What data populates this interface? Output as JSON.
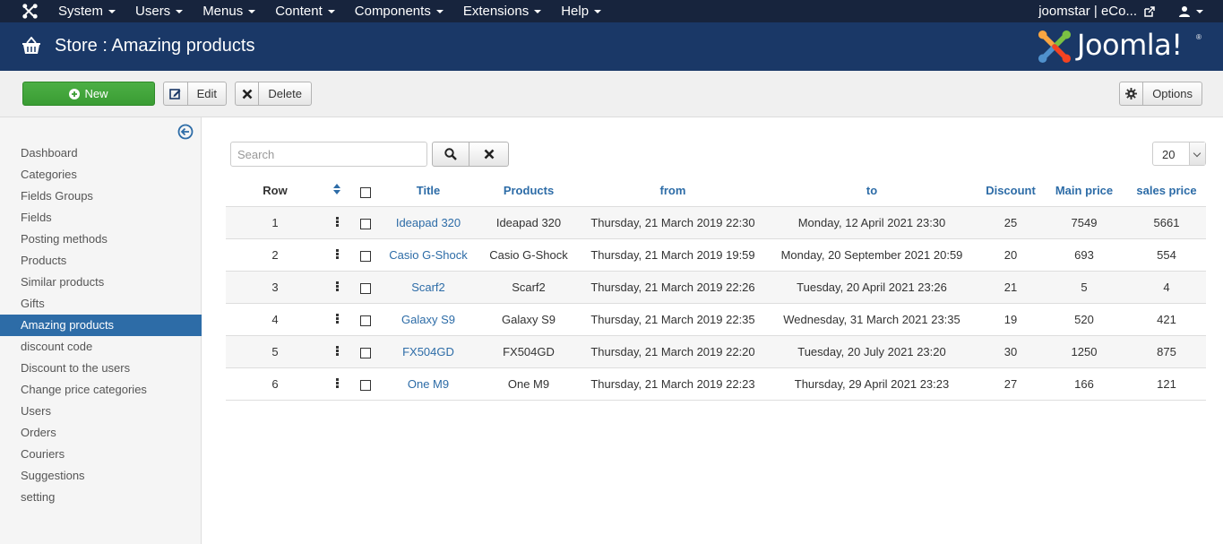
{
  "navbar": {
    "menus": [
      {
        "label": "System"
      },
      {
        "label": "Users"
      },
      {
        "label": "Menus"
      },
      {
        "label": "Content"
      },
      {
        "label": "Components"
      },
      {
        "label": "Extensions"
      },
      {
        "label": "Help"
      }
    ],
    "site_link": "joomstar | eCo..."
  },
  "header": {
    "title": "Store : Amazing products",
    "logo_text": "Joomla!",
    "logo_mark": "®"
  },
  "toolbar": {
    "new_label": "New",
    "edit_label": "Edit",
    "delete_label": "Delete",
    "options_label": "Options"
  },
  "sidebar": {
    "items": [
      {
        "label": "Dashboard"
      },
      {
        "label": "Categories"
      },
      {
        "label": "Fields Groups"
      },
      {
        "label": "Fields"
      },
      {
        "label": "Posting methods"
      },
      {
        "label": "Products"
      },
      {
        "label": "Similar products"
      },
      {
        "label": "Gifts"
      },
      {
        "label": "Amazing products",
        "active": true
      },
      {
        "label": "discount code"
      },
      {
        "label": "Discount to the users"
      },
      {
        "label": "Change price categories"
      },
      {
        "label": "Users"
      },
      {
        "label": "Orders"
      },
      {
        "label": "Couriers"
      },
      {
        "label": "Suggestions"
      },
      {
        "label": "setting"
      }
    ]
  },
  "filters": {
    "search_placeholder": "Search",
    "limit": "20"
  },
  "table": {
    "headers": {
      "row": "Row",
      "title": "Title",
      "products": "Products",
      "from": "from",
      "to": "to",
      "discount": "Discount",
      "main_price": "Main price",
      "sales_price": "sales price"
    },
    "rows": [
      {
        "row": "1",
        "title": "Ideapad 320",
        "product": "Ideapad 320",
        "from": "Thursday, 21 March 2019 22:30",
        "to": "Monday, 12 April 2021 23:30",
        "discount": "25",
        "main_price": "7549",
        "sales_price": "5661"
      },
      {
        "row": "2",
        "title": "Casio G-Shock",
        "product": "Casio G-Shock",
        "from": "Thursday, 21 March 2019 19:59",
        "to": "Monday, 20 September 2021 20:59",
        "discount": "20",
        "main_price": "693",
        "sales_price": "554"
      },
      {
        "row": "3",
        "title": "Scarf2",
        "product": "Scarf2",
        "from": "Thursday, 21 March 2019 22:26",
        "to": "Tuesday, 20 April 2021 23:26",
        "discount": "21",
        "main_price": "5",
        "sales_price": "4"
      },
      {
        "row": "4",
        "title": "Galaxy S9",
        "product": "Galaxy S9",
        "from": "Thursday, 21 March 2019 22:35",
        "to": "Wednesday, 31 March 2021 23:35",
        "discount": "19",
        "main_price": "520",
        "sales_price": "421"
      },
      {
        "row": "5",
        "title": "FX504GD",
        "product": "FX504GD",
        "from": "Thursday, 21 March 2019 22:20",
        "to": "Tuesday, 20 July 2021 23:20",
        "discount": "30",
        "main_price": "1250",
        "sales_price": "875"
      },
      {
        "row": "6",
        "title": "One M9",
        "product": "One M9",
        "from": "Thursday, 21 March 2019 22:23",
        "to": "Thursday, 29 April 2021 23:23",
        "discount": "27",
        "main_price": "166",
        "sales_price": "121"
      }
    ]
  },
  "colors": {
    "navbar_bg": "#17243d",
    "header_bg": "#1a3867",
    "accent": "#2d6ca7",
    "new_button": "#46a546"
  },
  "icons": {
    "brand": "joomla-icon",
    "store": "basket-icon",
    "external": "external-link-icon",
    "user": "user-icon",
    "new": "plus-circle-icon",
    "edit": "edit-icon",
    "delete": "close-icon",
    "options": "gear-icon",
    "collapse": "arrow-left-circle-icon",
    "search": "search-icon",
    "clear": "close-icon",
    "sort": "sort-icon",
    "drag": "drag-handle-icon"
  }
}
